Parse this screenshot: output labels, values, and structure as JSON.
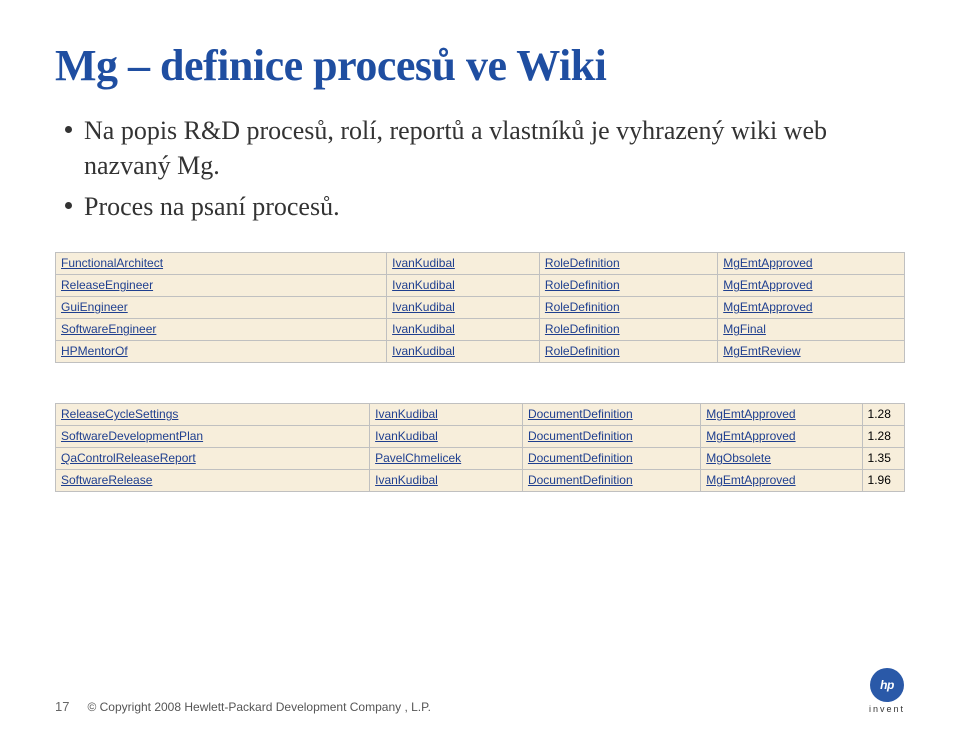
{
  "title": "Mg – definice procesů ve Wiki",
  "bullets": [
    "Na popis R&D procesů, rolí, reportů a vlastníků je vyhrazený wiki web nazvaný Mg.",
    "Proces na psaní procesů."
  ],
  "table1": [
    {
      "c1": "FunctionalArchitect",
      "c2": "IvanKudibal",
      "c3": "RoleDefinition",
      "c4": "MgEmtApproved"
    },
    {
      "c1": "ReleaseEngineer",
      "c2": "IvanKudibal",
      "c3": "RoleDefinition",
      "c4": "MgEmtApproved"
    },
    {
      "c1": "GuiEngineer",
      "c2": "IvanKudibal",
      "c3": "RoleDefinition",
      "c4": "MgEmtApproved"
    },
    {
      "c1": "SoftwareEngineer",
      "c2": "IvanKudibal",
      "c3": "RoleDefinition",
      "c4": "MgFinal"
    },
    {
      "c1": "HPMentorOf",
      "c2": "IvanKudibal",
      "c3": "RoleDefinition",
      "c4": "MgEmtReview"
    }
  ],
  "table2": [
    {
      "c1": "ReleaseCycleSettings",
      "c2": "IvanKudibal",
      "c3": "DocumentDefinition",
      "c4": "MgEmtApproved",
      "v": "1.28"
    },
    {
      "c1": "SoftwareDevelopmentPlan",
      "c2": "IvanKudibal",
      "c3": "DocumentDefinition",
      "c4": "MgEmtApproved",
      "v": "1.28"
    },
    {
      "c1": "QaControlReleaseReport",
      "c2": "PavelChmelicek",
      "c3": "DocumentDefinition",
      "c4": "MgObsolete",
      "v": "1.35"
    },
    {
      "c1": "SoftwareRelease",
      "c2": "IvanKudibal",
      "c3": "DocumentDefinition",
      "c4": "MgEmtApproved",
      "v": "1.96"
    }
  ],
  "footer": {
    "slide": "17",
    "copyright": "© Copyright 2008 Hewlett-Packard Development Company , L.P.",
    "logo_text": "hp",
    "invent": "invent"
  }
}
